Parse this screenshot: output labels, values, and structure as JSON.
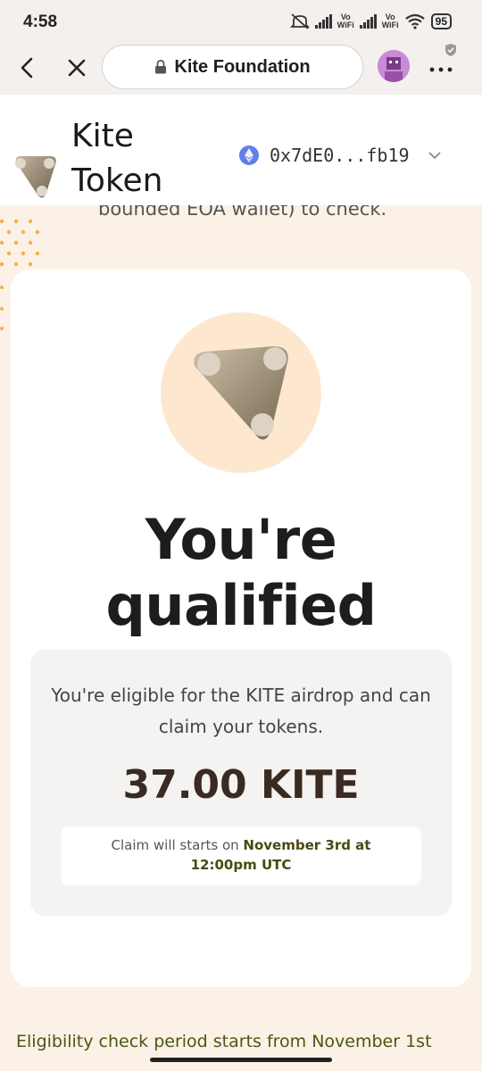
{
  "status_bar": {
    "time": "4:58",
    "network_label_1": "Vo\nWiFi",
    "network_label_2": "Vo\nWiFi",
    "battery": "95",
    "icons": [
      "mute-icon",
      "signal-icon",
      "signal-icon",
      "wifi-icon",
      "battery-icon"
    ]
  },
  "browser": {
    "url_title": "Kite Foundation",
    "icons": [
      "back-icon",
      "close-icon",
      "lock-icon",
      "avatar",
      "more-icon"
    ]
  },
  "site_header": {
    "brand_line1": "Kite",
    "brand_line2": "Token",
    "wallet_address": "0x7dE0...fb19",
    "icons": [
      "kite-logo-icon",
      "ethereum-icon",
      "chevron-down-icon"
    ]
  },
  "background": {
    "partial_text": "bounded EOA wallet) to check."
  },
  "card": {
    "headline_line1": "You're",
    "headline_line2": "qualified",
    "eligible_text": "You're eligible for the KITE airdrop and can claim your tokens.",
    "amount": "37.00 KITE",
    "claim_prefix": "Claim will starts on",
    "claim_date": "November 3rd at",
    "claim_time": "12:00pm UTC"
  },
  "footer": {
    "eligibility_text": "Eligibility check period starts from November 1st"
  },
  "colors": {
    "accent_orange": "#f4a340",
    "hero_circle": "#fde8cf",
    "claim_text": "#4a4a12",
    "footer_text": "#4b5713"
  }
}
